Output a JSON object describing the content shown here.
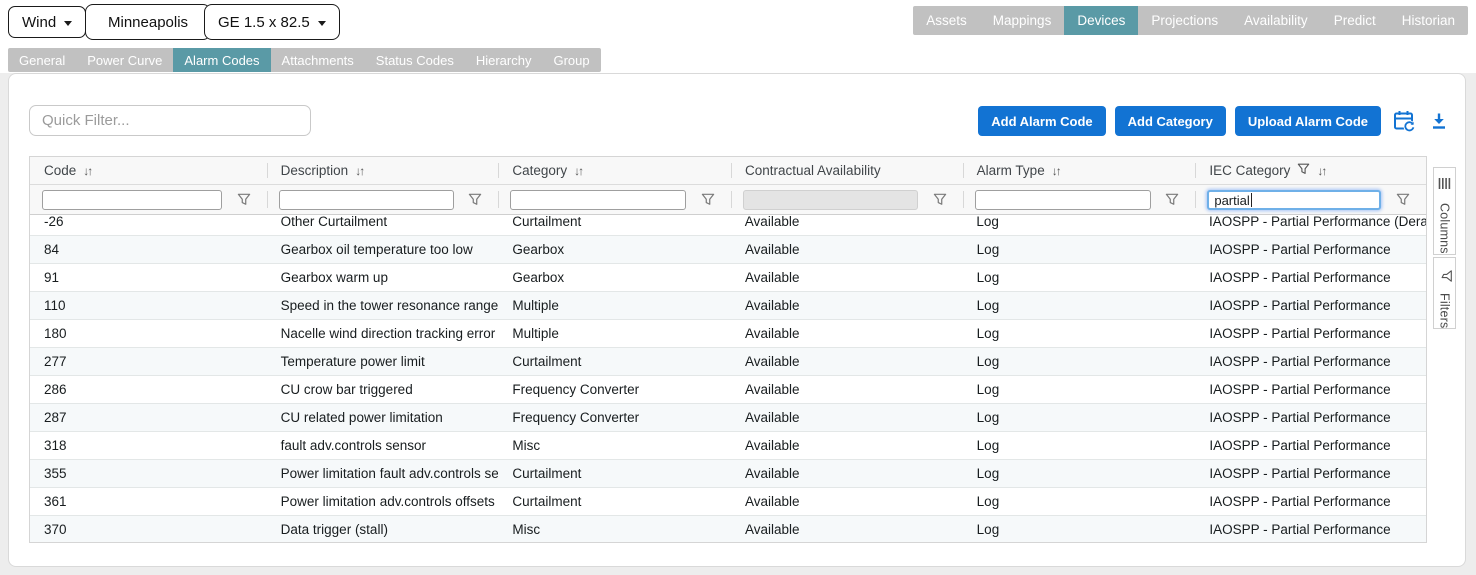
{
  "topbar": {
    "selectors": [
      {
        "label": "Wind",
        "caret": true
      },
      {
        "label": "Minneapolis",
        "caret": false
      },
      {
        "label": "GE 1.5 x 82.5",
        "caret": true
      }
    ],
    "nav_items": [
      "Assets",
      "Mappings",
      "Devices",
      "Projections",
      "Availability",
      "Predict",
      "Historian"
    ],
    "nav_active": "Devices"
  },
  "subtabs": {
    "items": [
      "General",
      "Power Curve",
      "Alarm Codes",
      "Attachments",
      "Status Codes",
      "Hierarchy",
      "Group"
    ],
    "active": "Alarm Codes"
  },
  "toolbar": {
    "quick_filter_placeholder": "Quick Filter...",
    "buttons": [
      "Add Alarm Code",
      "Add Category",
      "Upload Alarm Code"
    ],
    "icons": [
      "calendar-refresh-icon",
      "download-icon"
    ]
  },
  "grid": {
    "sort_glyph": "↓↑",
    "columns": [
      {
        "label": "Code",
        "sortable": true,
        "header_filter": false,
        "filter_value": "",
        "filter_state": "normal"
      },
      {
        "label": "Description",
        "sortable": true,
        "header_filter": false,
        "filter_value": "",
        "filter_state": "normal"
      },
      {
        "label": "Category",
        "sortable": true,
        "header_filter": false,
        "filter_value": "",
        "filter_state": "normal"
      },
      {
        "label": "Contractual Availability",
        "sortable": false,
        "header_filter": false,
        "filter_value": "",
        "filter_state": "disabled"
      },
      {
        "label": "Alarm Type",
        "sortable": true,
        "header_filter": false,
        "filter_value": "",
        "filter_state": "normal"
      },
      {
        "label": "IEC Category",
        "sortable": true,
        "header_filter": true,
        "filter_value": "partial",
        "filter_state": "focused"
      }
    ],
    "rows": [
      [
        "-26",
        "Other Curtailment",
        "Curtailment",
        "Available",
        "Log",
        "IAOSPP - Partial Performance (Derated"
      ],
      [
        "84",
        "Gearbox oil temperature too low",
        "Gearbox",
        "Available",
        "Log",
        "IAOSPP - Partial Performance"
      ],
      [
        "91",
        "Gearbox warm up",
        "Gearbox",
        "Available",
        "Log",
        "IAOSPP - Partial Performance"
      ],
      [
        "110",
        "Speed in the tower resonance range",
        "Multiple",
        "Available",
        "Log",
        "IAOSPP - Partial Performance"
      ],
      [
        "180",
        "Nacelle wind direction tracking error",
        "Multiple",
        "Available",
        "Log",
        "IAOSPP - Partial Performance"
      ],
      [
        "277",
        "Temperature power limit",
        "Curtailment",
        "Available",
        "Log",
        "IAOSPP - Partial Performance"
      ],
      [
        "286",
        "CU crow bar triggered",
        "Frequency Converter",
        "Available",
        "Log",
        "IAOSPP - Partial Performance"
      ],
      [
        "287",
        "CU related power limitation",
        "Frequency Converter",
        "Available",
        "Log",
        "IAOSPP - Partial Performance"
      ],
      [
        "318",
        "fault adv.controls sensor",
        "Misc",
        "Available",
        "Log",
        "IAOSPP - Partial Performance"
      ],
      [
        "355",
        "Power limitation fault adv.controls sens",
        "Curtailment",
        "Available",
        "Log",
        "IAOSPP - Partial Performance"
      ],
      [
        "361",
        "Power limitation adv.controls offsets",
        "Curtailment",
        "Available",
        "Log",
        "IAOSPP - Partial Performance"
      ],
      [
        "370",
        "Data trigger (stall)",
        "Misc",
        "Available",
        "Log",
        "IAOSPP - Partial Performance"
      ]
    ]
  },
  "side_panel": {
    "tabs": [
      {
        "label": "Columns",
        "icon": "columns-icon"
      },
      {
        "label": "Filters",
        "icon": "filter-icon"
      }
    ]
  },
  "colors": {
    "accent_teal": "#5a9aa6",
    "accent_blue": "#1273d3",
    "tab_gray": "#c1c1c1"
  }
}
